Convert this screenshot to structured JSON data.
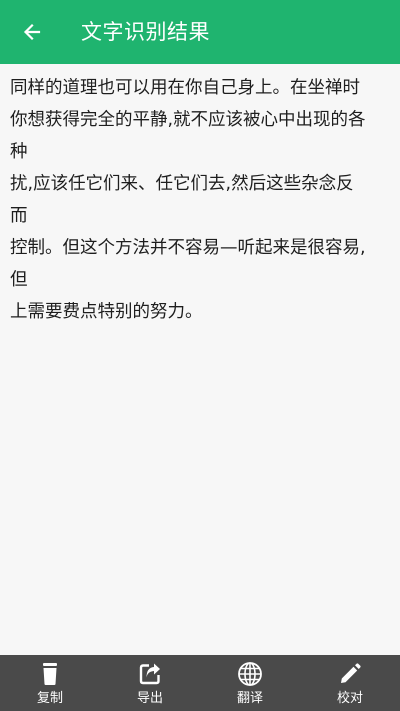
{
  "header": {
    "title": "文字识别结果",
    "back_icon": "arrow-left-icon"
  },
  "content": {
    "lines": [
      "同样的道理也可以用在你自己身上。在坐禅时",
      "你想获得完全的平静,就不应该被心中出现的各",
      "种",
      "扰,应该任它们来、任它们去,然后这些杂念反",
      "而",
      "控制。但这个方法并不容易—听起来是很容易,",
      "但",
      "上需要费点特别的努力。"
    ]
  },
  "toolbar": {
    "items": [
      {
        "label": "复制",
        "icon": "trash-icon"
      },
      {
        "label": "导出",
        "icon": "share-icon"
      },
      {
        "label": "翻译",
        "icon": "globe-icon"
      },
      {
        "label": "校对",
        "icon": "pencil-icon"
      }
    ]
  },
  "colors": {
    "header_bg": "#1fb46f",
    "toolbar_bg": "#4a4a4a",
    "page_bg": "#f7f7f7"
  }
}
